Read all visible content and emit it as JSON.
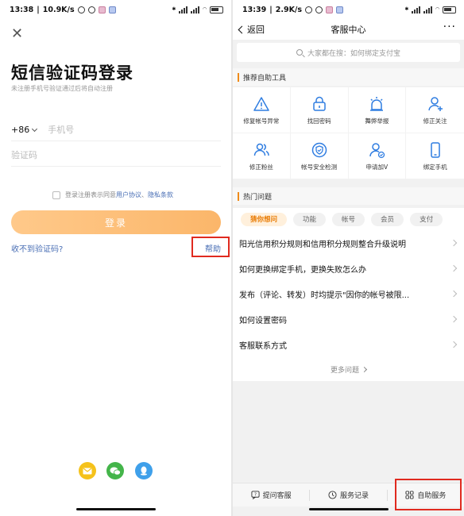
{
  "left": {
    "status": {
      "time": "13:38",
      "speed": "10.9K/s"
    },
    "title": "短信验证码登录",
    "subtitle": "未注册手机号验证通过后将自动注册",
    "country_code": "+86",
    "phone_placeholder": "手机号",
    "code_placeholder": "验证码",
    "agree_prefix": "登录注册表示同意",
    "agree_user": "用户协议",
    "agree_sep": "、",
    "agree_privacy": "隐私条款",
    "login_label": "登录",
    "no_code_label": "收不到验证码?",
    "help_label": "帮助"
  },
  "right": {
    "status": {
      "time": "13:39",
      "speed": "2.9K/s"
    },
    "back_label": "返回",
    "title": "客服中心",
    "more_label": "···",
    "search_placeholder": "大家都在搜：如何绑定支付宝",
    "tools_header": "推荐自助工具",
    "tools": [
      {
        "label": "修复帐号异常",
        "icon": "warning-icon"
      },
      {
        "label": "找回密码",
        "icon": "lock-icon"
      },
      {
        "label": "舞弊举报",
        "icon": "alarm-icon"
      },
      {
        "label": "修正关注",
        "icon": "user-add-icon"
      },
      {
        "label": "修正粉丝",
        "icon": "users-icon"
      },
      {
        "label": "帐号安全检测",
        "icon": "shield-icon"
      },
      {
        "label": "申请加V",
        "icon": "verified-user-icon"
      },
      {
        "label": "绑定手机",
        "icon": "phone-icon"
      }
    ],
    "hot_header": "热门问题",
    "categories": [
      "猜你想问",
      "功能",
      "帐号",
      "会员",
      "支付"
    ],
    "questions": [
      "阳光信用积分规则和信用积分规则整合升级说明",
      "如何更换绑定手机，更换失败怎么办",
      "发布（评论、转发）时均提示\"因你的帐号被限...",
      "如何设置密码",
      "客服联系方式"
    ],
    "more_questions": "更多问题",
    "bottom": {
      "ask": "提问客服",
      "records": "服务记录",
      "self_service": "自助服务"
    }
  },
  "colors": {
    "accent_orange": "#f08b19",
    "link_blue": "#4a6fb5",
    "highlight_red": "#e02a1f",
    "icon_blue": "#2f7de1"
  }
}
